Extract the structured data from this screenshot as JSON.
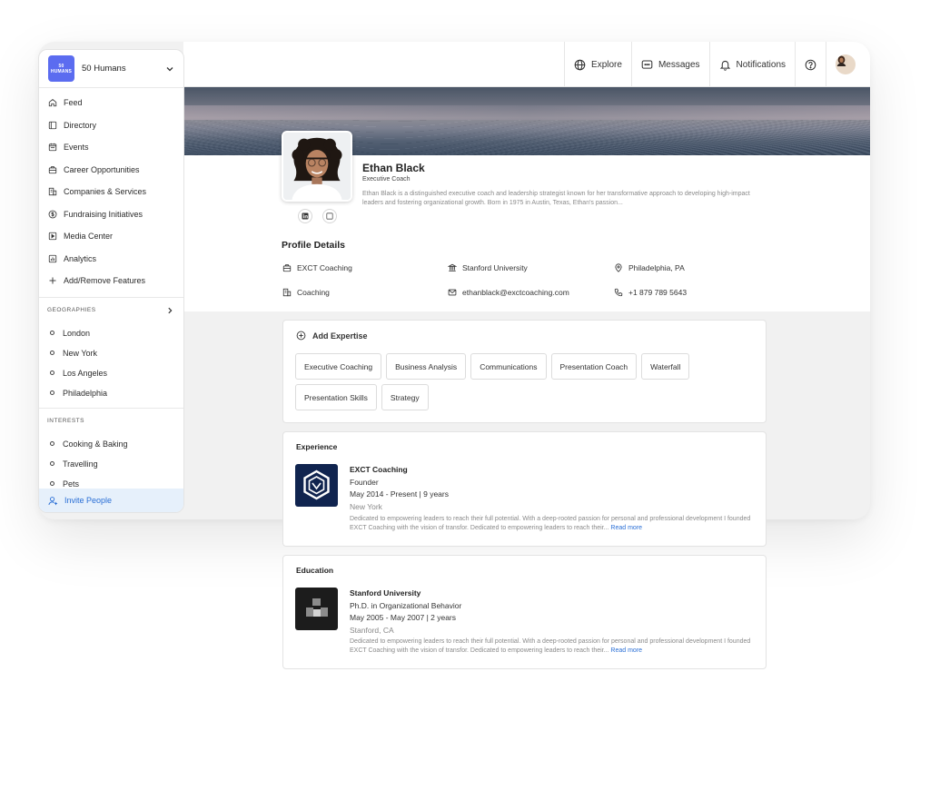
{
  "topbar": {
    "explore": "Explore",
    "messages": "Messages",
    "notifications": "Notifications"
  },
  "sidebar": {
    "logo_line1": "50",
    "logo_line2": "HUMANS",
    "org_name": "50 Humans",
    "nav": [
      {
        "label": "Feed",
        "icon": "home-icon"
      },
      {
        "label": "Directory",
        "icon": "book-icon"
      },
      {
        "label": "Events",
        "icon": "calendar-icon"
      },
      {
        "label": "Career Opportunities",
        "icon": "briefcase-icon"
      },
      {
        "label": "Companies & Services",
        "icon": "building-icon"
      },
      {
        "label": "Fundraising Initiatives",
        "icon": "dollar-icon"
      },
      {
        "label": "Media Center",
        "icon": "play-icon"
      },
      {
        "label": "Analytics",
        "icon": "chart-icon"
      },
      {
        "label": "Add/Remove Features",
        "icon": "plus-icon"
      }
    ],
    "geographies_title": "GEOGRAPHIES",
    "geographies": [
      "London",
      "New York",
      "Los Angeles",
      "Philadelphia"
    ],
    "interests_title": "INTERESTS",
    "interests": [
      "Cooking & Baking",
      "Travelling",
      "Pets"
    ],
    "invite": "Invite People"
  },
  "profile": {
    "name": "Ethan Black",
    "role": "Executive Coach",
    "bio": "Ethan Black is a distinguished executive coach and leadership strategist known for her transformative approach to developing high-impact leaders and fostering organizational growth. Born in 1975 in Austin, Texas, Ethan's passion...",
    "details_title": "Profile Details",
    "company": "EXCT Coaching",
    "school": "Stanford University",
    "location": "Philadelphia, PA",
    "industry": "Coaching",
    "email": "ethanblack@exctcoaching.com",
    "phone": "+1 879 789 5643"
  },
  "expertise": {
    "add_label": "Add Expertise",
    "chips": [
      "Executive Coaching",
      "Business Analysis",
      "Communications",
      "Presentation Coach",
      "Waterfall",
      "Presentation Skills",
      "Strategy"
    ]
  },
  "experience": {
    "title": "Experience",
    "org": "EXCT Coaching",
    "position": "Founder",
    "dates": "May 2014 - Present | 9 years",
    "place": "New York",
    "desc": "Dedicated to empowering leaders to reach their full potential. With a deep-rooted passion for personal and professional development I founded EXCT Coaching with the vision of transfor. Dedicated to empowering leaders to reach their...",
    "read_more": "Read more"
  },
  "education": {
    "title": "Education",
    "org": "Stanford University",
    "degree": "Ph.D. in Organizational Behavior",
    "dates": "May 2005 - May 2007 | 2 years",
    "place": "Stanford, CA",
    "desc": "Dedicated to empowering leaders to reach their full potential. With a deep-rooted passion for personal and professional development I founded EXCT Coaching with the vision of transfor. Dedicated to empowering leaders to reach their...",
    "read_more": "Read more"
  },
  "colors": {
    "accent": "#2a6fd6",
    "logo": "#5b6cf0",
    "exp_logo": "#10244f",
    "edu_logo": "#1c1c1c"
  }
}
